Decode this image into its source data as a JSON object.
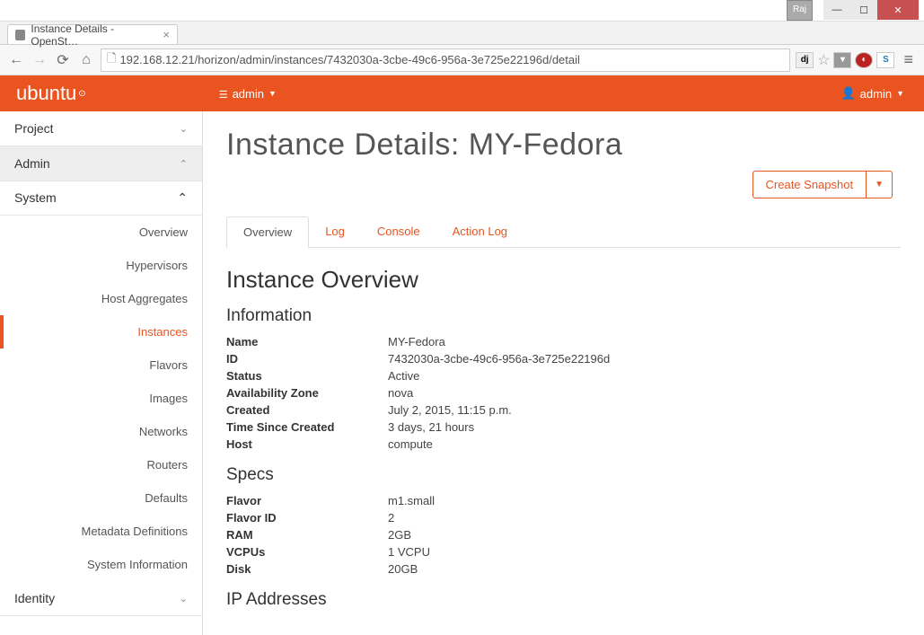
{
  "window": {
    "user_badge": "Raj"
  },
  "browser": {
    "tab_title": "Instance Details - OpenSt…",
    "url": "192.168.12.21/horizon/admin/instances/7432030a-3cbe-49c6-956a-3e725e22196d/detail"
  },
  "header": {
    "brand": "ubuntu",
    "project_dropdown": "admin",
    "user_dropdown": "admin"
  },
  "sidebar": {
    "panels": {
      "project": "Project",
      "admin": "Admin",
      "system": "System",
      "identity": "Identity"
    },
    "items": [
      "Overview",
      "Hypervisors",
      "Host Aggregates",
      "Instances",
      "Flavors",
      "Images",
      "Networks",
      "Routers",
      "Defaults",
      "Metadata Definitions",
      "System Information"
    ],
    "active_item": "Instances"
  },
  "page": {
    "title": "Instance Details: MY-Fedora",
    "action_button": "Create Snapshot",
    "tabs": [
      "Overview",
      "Log",
      "Console",
      "Action Log"
    ],
    "active_tab": "Overview"
  },
  "overview": {
    "section_title": "Instance Overview",
    "information": {
      "heading": "Information",
      "rows": {
        "Name": "MY-Fedora",
        "ID": "7432030a-3cbe-49c6-956a-3e725e22196d",
        "Status": "Active",
        "Availability Zone": "nova",
        "Created": "July 2, 2015, 11:15 p.m.",
        "Time Since Created": "3 days, 21 hours",
        "Host": "compute"
      }
    },
    "specs": {
      "heading": "Specs",
      "rows": {
        "Flavor": "m1.small",
        "Flavor ID": "2",
        "RAM": "2GB",
        "VCPUs": "1 VCPU",
        "Disk": "20GB"
      }
    },
    "ip": {
      "heading": "IP Addresses"
    }
  }
}
